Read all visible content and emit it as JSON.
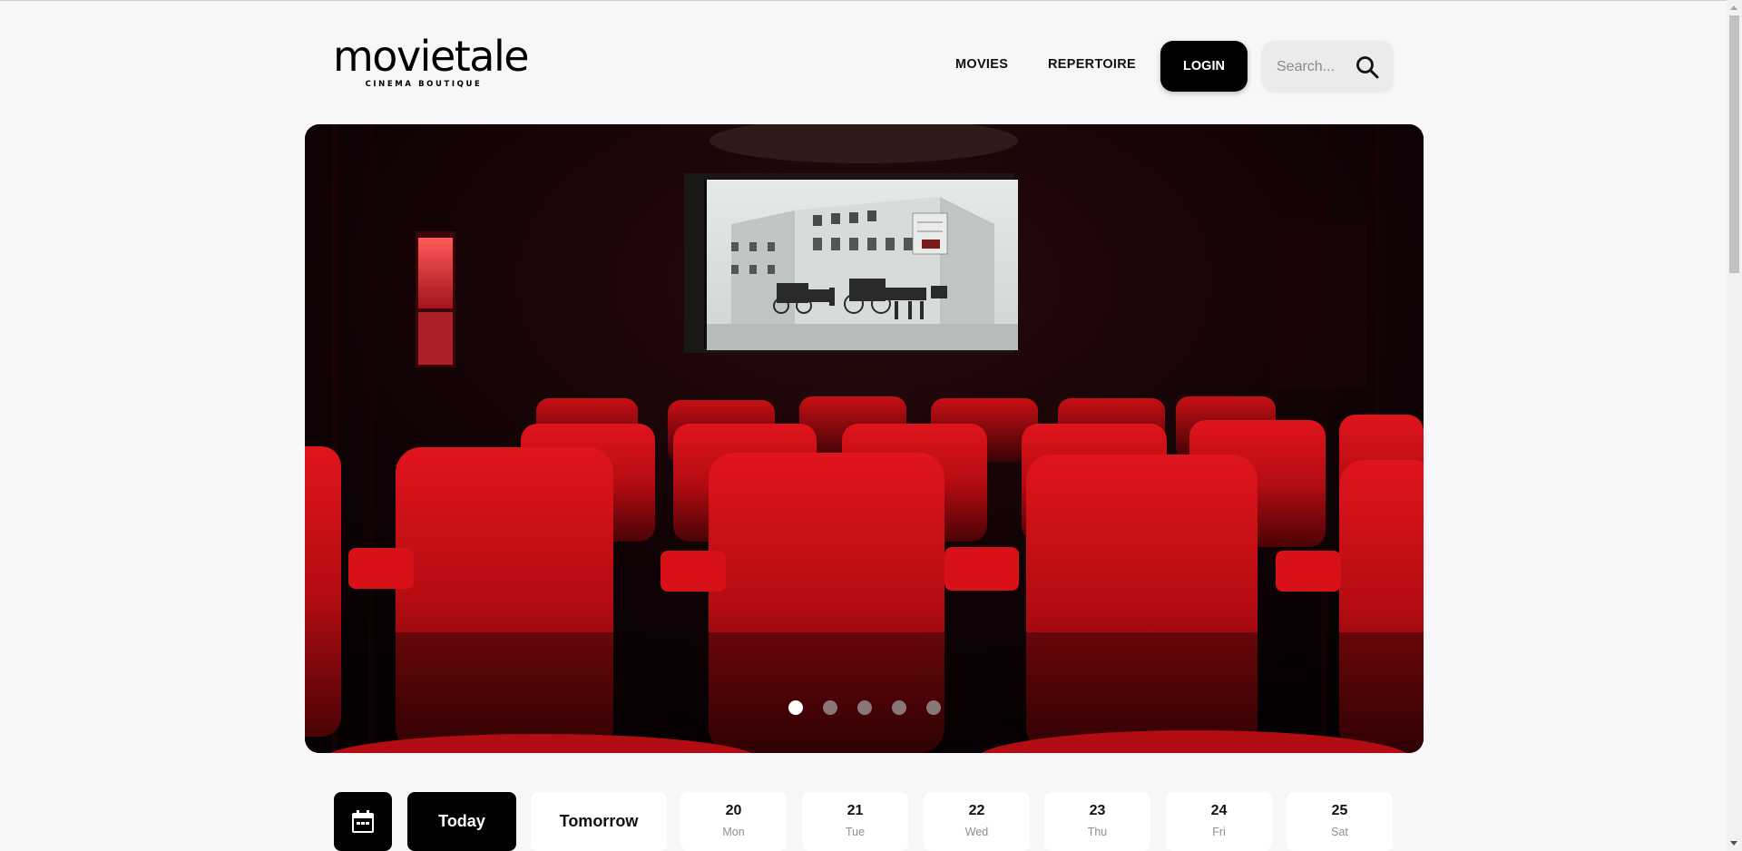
{
  "header": {
    "logo_main": "movietale",
    "logo_sub": "CINEMA BOUTIQUE",
    "nav": {
      "movies": "MOVIES",
      "repertoire": "REPERTOIRE",
      "login": "LOGIN"
    },
    "search": {
      "placeholder": "Search...",
      "icon": "search-icon"
    }
  },
  "hero": {
    "image": "cinema-auditorium-red-seats",
    "slides_count": 5,
    "active_slide": 1
  },
  "dates": {
    "calendar_icon": "calendar-icon",
    "today": "Today",
    "tomorrow": "Tomorrow",
    "days": [
      {
        "num": "20",
        "name": "Mon"
      },
      {
        "num": "21",
        "name": "Tue"
      },
      {
        "num": "22",
        "name": "Wed"
      },
      {
        "num": "23",
        "name": "Thu"
      },
      {
        "num": "24",
        "name": "Fri"
      },
      {
        "num": "25",
        "name": "Sat"
      }
    ]
  },
  "colors": {
    "background": "#f7f7f9",
    "accent": "#000000",
    "seat_red": "#c40f16"
  }
}
